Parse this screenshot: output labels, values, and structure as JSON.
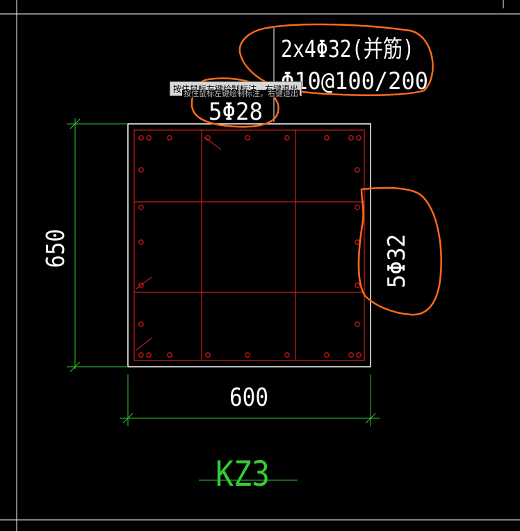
{
  "drawing": {
    "column_id": "KZ3",
    "section": {
      "width": 600,
      "height": 650
    },
    "annotations": {
      "top_reinforcement": "2x4Φ32(并筋)",
      "stirrups": "Φ10@100/200",
      "side_top_bars": "5Φ28",
      "side_right_bars": "5Φ32"
    },
    "tooltip": "按住鼠标左键绘制标注，右键退出",
    "tooltip_ghost": "按住鼠标左键绘制标注，右键退出"
  },
  "colors": {
    "background": "#000000",
    "frame": "#ffffff",
    "rebar": "#ff2020",
    "dimension": "#33cc33",
    "highlight": "#ff6a1a"
  }
}
